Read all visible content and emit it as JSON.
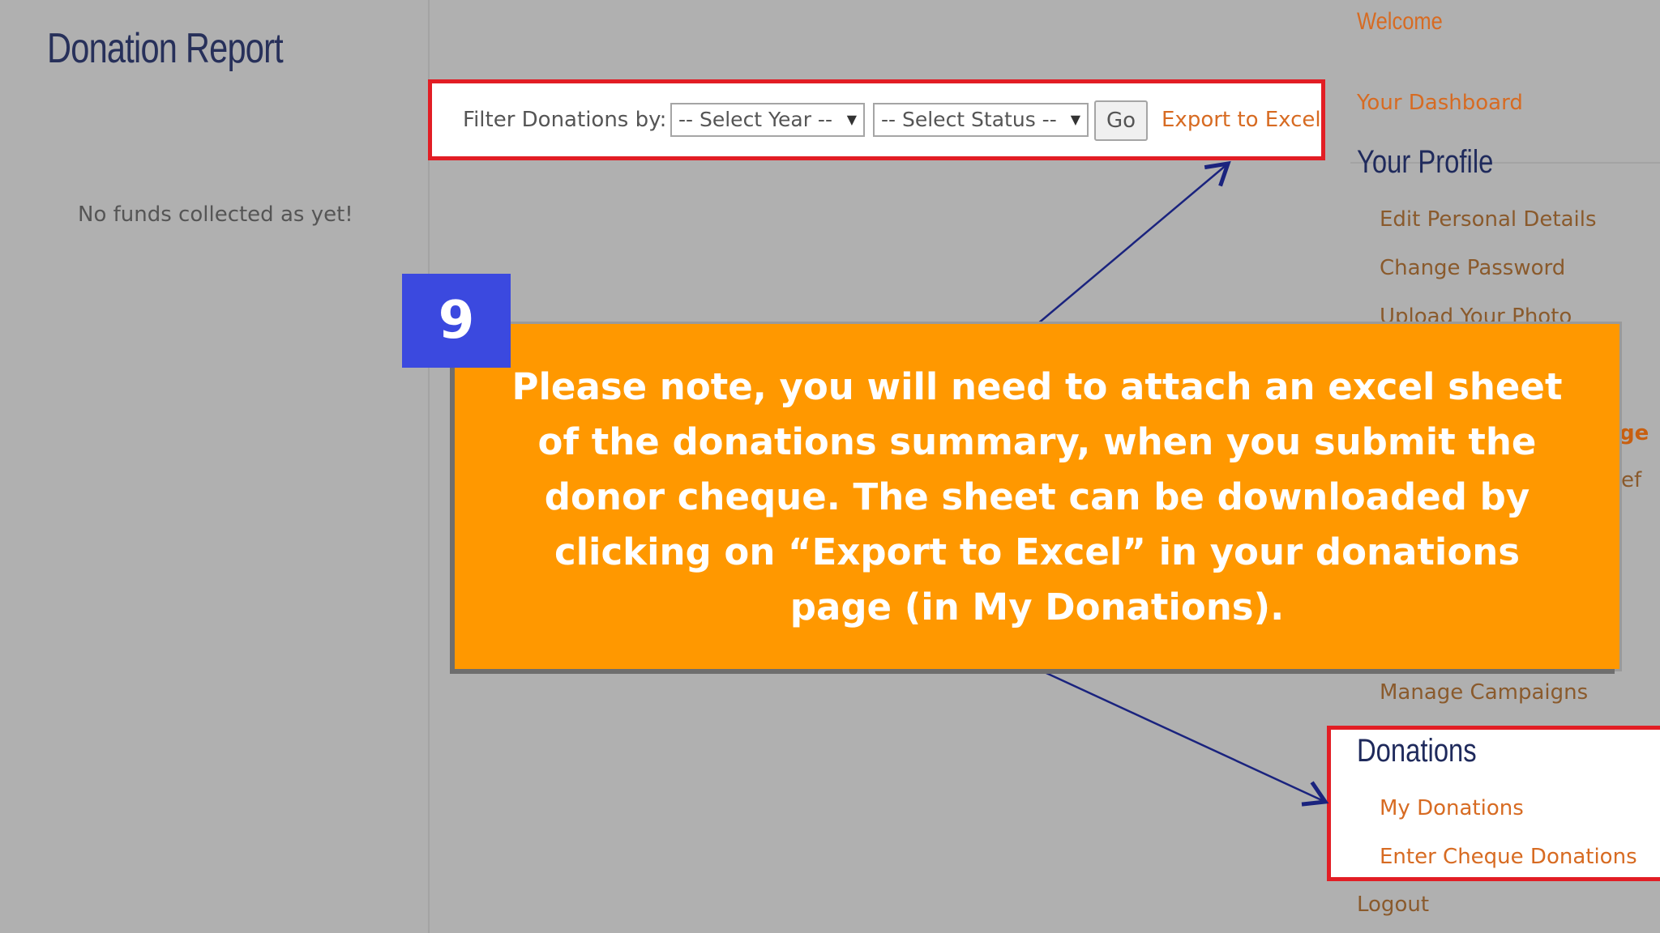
{
  "page_title": "Donation Report",
  "left_panel": {
    "empty_message": "No funds collected as yet!"
  },
  "filter": {
    "label": "Filter Donations by:",
    "year_select": "-- Select Year --",
    "status_select": "-- Select Status --",
    "go_label": "Go",
    "export_label": "Export to Excel"
  },
  "sidebar": {
    "welcome": "Welcome",
    "dashboard": "Your Dashboard",
    "profile_heading": "Your Profile",
    "profile_items": [
      "Edit Personal Details",
      "Change Password",
      "Upload Your Photo"
    ],
    "partial_items": [
      "ge",
      "ef"
    ],
    "manage_campaigns": "Manage Campaigns",
    "donations_heading": "Donations",
    "donations_items": [
      "My Donations",
      "Enter Cheque Donations"
    ],
    "logout": "Logout"
  },
  "callout": {
    "step_number": "9",
    "text": "Please note, you will need to attach an excel sheet of the donations summary, when you submit the donor cheque. The sheet can be downloaded by clicking on “Export to Excel” in your donations page (in My Donations)."
  },
  "colors": {
    "callout_bg": "#ff9800",
    "badge_bg": "#3b49df",
    "highlight_border": "#e21d24",
    "arrow": "#1a237e",
    "link_orange": "#d76b22"
  }
}
